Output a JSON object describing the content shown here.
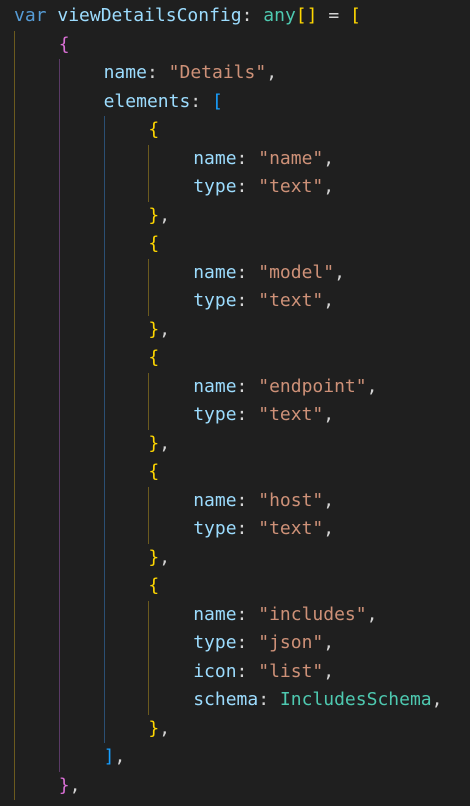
{
  "editor": {
    "theme_colors": {
      "background": "#1f1f1f",
      "keyword": "#569cd6",
      "variable": "#9cdcfe",
      "type": "#4ec9b0",
      "string": "#ce9178",
      "punctuation": "#d4d4d4",
      "bracket_level_1": "#ffd700",
      "bracket_level_2": "#da70d6",
      "bracket_level_3": "#179fff"
    },
    "lines": [
      {
        "indent": 0,
        "tokens": [
          [
            "kw",
            "var"
          ],
          [
            "p",
            " "
          ],
          [
            "var",
            "viewDetailsConfig"
          ],
          [
            "p",
            ": "
          ],
          [
            "type",
            "any"
          ],
          [
            "b1",
            "[]"
          ],
          [
            "p",
            " = "
          ],
          [
            "b1",
            "["
          ]
        ]
      },
      {
        "indent": 4,
        "tokens": [
          [
            "b2",
            "{"
          ]
        ]
      },
      {
        "indent": 8,
        "tokens": [
          [
            "var",
            "name"
          ],
          [
            "p",
            ": "
          ],
          [
            "str",
            "\"Details\""
          ],
          [
            "p",
            ","
          ]
        ]
      },
      {
        "indent": 8,
        "tokens": [
          [
            "var",
            "elements"
          ],
          [
            "p",
            ": "
          ],
          [
            "b3",
            "["
          ]
        ]
      },
      {
        "indent": 12,
        "tokens": [
          [
            "b1",
            "{"
          ]
        ]
      },
      {
        "indent": 16,
        "tokens": [
          [
            "var",
            "name"
          ],
          [
            "p",
            ": "
          ],
          [
            "str",
            "\"name\""
          ],
          [
            "p",
            ","
          ]
        ]
      },
      {
        "indent": 16,
        "tokens": [
          [
            "var",
            "type"
          ],
          [
            "p",
            ": "
          ],
          [
            "str",
            "\"text\""
          ],
          [
            "p",
            ","
          ]
        ]
      },
      {
        "indent": 12,
        "tokens": [
          [
            "b1",
            "}"
          ],
          [
            "p",
            ","
          ]
        ]
      },
      {
        "indent": 12,
        "tokens": [
          [
            "b1",
            "{"
          ]
        ]
      },
      {
        "indent": 16,
        "tokens": [
          [
            "var",
            "name"
          ],
          [
            "p",
            ": "
          ],
          [
            "str",
            "\"model\""
          ],
          [
            "p",
            ","
          ]
        ]
      },
      {
        "indent": 16,
        "tokens": [
          [
            "var",
            "type"
          ],
          [
            "p",
            ": "
          ],
          [
            "str",
            "\"text\""
          ],
          [
            "p",
            ","
          ]
        ]
      },
      {
        "indent": 12,
        "tokens": [
          [
            "b1",
            "}"
          ],
          [
            "p",
            ","
          ]
        ]
      },
      {
        "indent": 12,
        "tokens": [
          [
            "b1",
            "{"
          ]
        ]
      },
      {
        "indent": 16,
        "tokens": [
          [
            "var",
            "name"
          ],
          [
            "p",
            ": "
          ],
          [
            "str",
            "\"endpoint\""
          ],
          [
            "p",
            ","
          ]
        ]
      },
      {
        "indent": 16,
        "tokens": [
          [
            "var",
            "type"
          ],
          [
            "p",
            ": "
          ],
          [
            "str",
            "\"text\""
          ],
          [
            "p",
            ","
          ]
        ]
      },
      {
        "indent": 12,
        "tokens": [
          [
            "b1",
            "}"
          ],
          [
            "p",
            ","
          ]
        ]
      },
      {
        "indent": 12,
        "tokens": [
          [
            "b1",
            "{"
          ]
        ]
      },
      {
        "indent": 16,
        "tokens": [
          [
            "var",
            "name"
          ],
          [
            "p",
            ": "
          ],
          [
            "str",
            "\"host\""
          ],
          [
            "p",
            ","
          ]
        ]
      },
      {
        "indent": 16,
        "tokens": [
          [
            "var",
            "type"
          ],
          [
            "p",
            ": "
          ],
          [
            "str",
            "\"text\""
          ],
          [
            "p",
            ","
          ]
        ]
      },
      {
        "indent": 12,
        "tokens": [
          [
            "b1",
            "}"
          ],
          [
            "p",
            ","
          ]
        ]
      },
      {
        "indent": 12,
        "tokens": [
          [
            "b1",
            "{"
          ]
        ]
      },
      {
        "indent": 16,
        "tokens": [
          [
            "var",
            "name"
          ],
          [
            "p",
            ": "
          ],
          [
            "str",
            "\"includes\""
          ],
          [
            "p",
            ","
          ]
        ]
      },
      {
        "indent": 16,
        "tokens": [
          [
            "var",
            "type"
          ],
          [
            "p",
            ": "
          ],
          [
            "str",
            "\"json\""
          ],
          [
            "p",
            ","
          ]
        ]
      },
      {
        "indent": 16,
        "tokens": [
          [
            "var",
            "icon"
          ],
          [
            "p",
            ": "
          ],
          [
            "str",
            "\"list\""
          ],
          [
            "p",
            ","
          ]
        ]
      },
      {
        "indent": 16,
        "tokens": [
          [
            "var",
            "schema"
          ],
          [
            "p",
            ": "
          ],
          [
            "type",
            "IncludesSchema"
          ],
          [
            "p",
            ","
          ]
        ]
      },
      {
        "indent": 12,
        "tokens": [
          [
            "b1",
            "}"
          ],
          [
            "p",
            ","
          ]
        ]
      },
      {
        "indent": 8,
        "tokens": [
          [
            "b3",
            "]"
          ],
          [
            "p",
            ","
          ]
        ]
      },
      {
        "indent": 4,
        "tokens": [
          [
            "b2",
            "}"
          ],
          [
            "p",
            ","
          ]
        ]
      }
    ]
  }
}
